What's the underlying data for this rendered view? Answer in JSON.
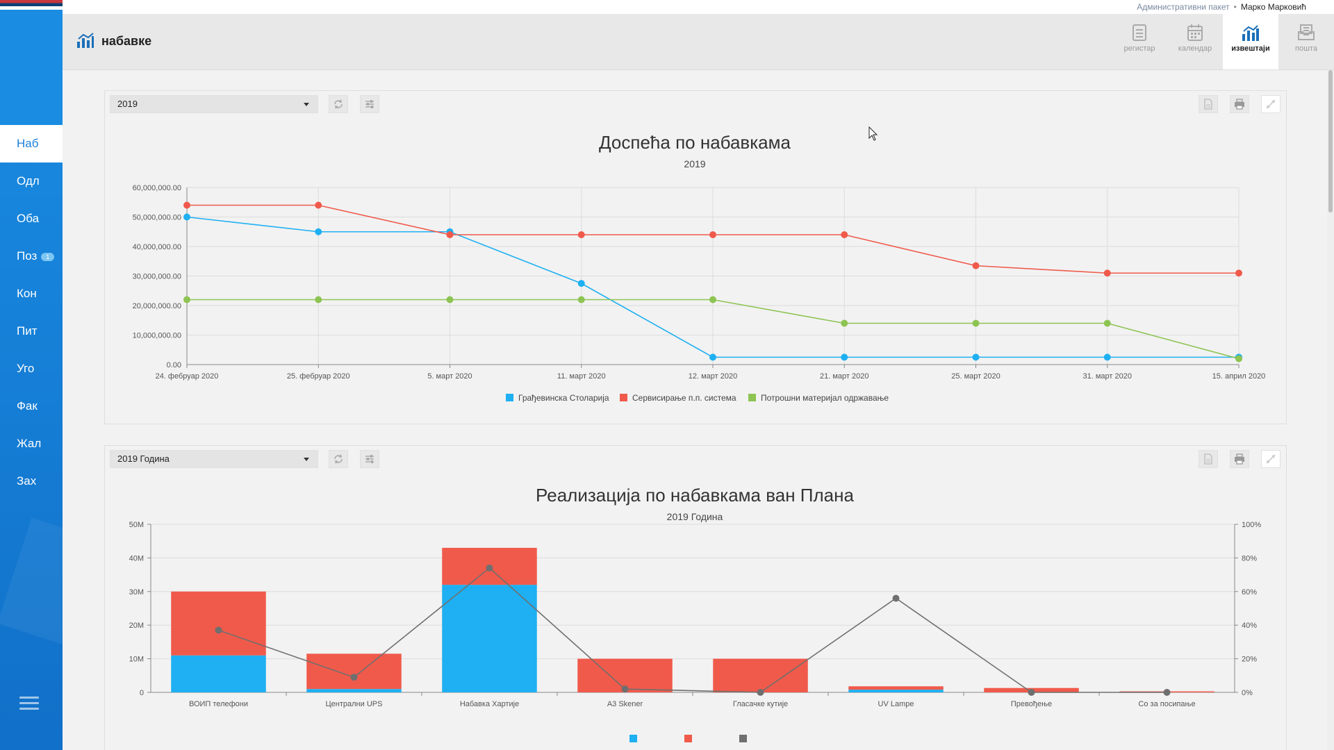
{
  "user_bar": {
    "package": "Административни пакет",
    "user": "Марко Марковић"
  },
  "header": {
    "title": "набавке",
    "tabs": [
      {
        "label": "регистар",
        "icon": "register-icon",
        "active": false
      },
      {
        "label": "календар",
        "icon": "calendar-icon",
        "active": false
      },
      {
        "label": "извештаји",
        "icon": "reports-icon",
        "active": true
      },
      {
        "label": "пошта",
        "icon": "mail-icon",
        "active": false
      }
    ]
  },
  "sidebar": {
    "items": [
      {
        "label": "Наб",
        "active": true
      },
      {
        "label": "Одл"
      },
      {
        "label": "Оба"
      },
      {
        "label": "Поз",
        "badge": "1"
      },
      {
        "label": "Кон"
      },
      {
        "label": "Пит"
      },
      {
        "label": "Уго"
      },
      {
        "label": "Фак"
      },
      {
        "label": "Жал"
      },
      {
        "label": "Зах"
      }
    ]
  },
  "panels": [
    {
      "dropdown_value": "2019"
    },
    {
      "dropdown_value": "2019 Година"
    }
  ],
  "colors": {
    "blue": "#1eb0f2",
    "red": "#f05a4b",
    "green": "#8dc452",
    "gray": "#6f6f6f",
    "accent": "#1a8de3"
  },
  "chart_data": [
    {
      "type": "line",
      "title": "Доспећа по набавкама",
      "subtitle": "2019",
      "categories": [
        "24. фебруар 2020",
        "25. фебруар 2020",
        "5. март 2020",
        "11. март 2020",
        "12. март 2020",
        "21. март 2020",
        "25. март 2020",
        "31. март 2020",
        "15. април 2020"
      ],
      "ylim": [
        0,
        60000000
      ],
      "yticks": [
        "0.00",
        "10,000,000.00",
        "20,000,000.00",
        "30,000,000.00",
        "40,000,000.00",
        "50,000,000.00",
        "60,000,000.00"
      ],
      "grid": true,
      "legend": "bottom",
      "series": [
        {
          "name": "Грађевинска Столарија",
          "color": "#1eb0f2",
          "values": [
            50000000,
            45000000,
            45000000,
            27500000,
            2500000,
            2500000,
            2500000,
            2500000,
            2500000
          ]
        },
        {
          "name": "Сервисирање п.п. система",
          "color": "#f05a4b",
          "values": [
            54000000,
            54000000,
            44000000,
            44000000,
            44000000,
            44000000,
            33500000,
            31000000,
            31000000
          ]
        },
        {
          "name": "Потрошни материјал одржавање",
          "color": "#8dc452",
          "values": [
            22000000,
            22000000,
            22000000,
            22000000,
            22000000,
            14000000,
            14000000,
            14000000,
            2000000
          ]
        }
      ]
    },
    {
      "type": "bar",
      "stacked": true,
      "title": "Реализација по набавкама ван Плана",
      "subtitle": "2019 Година",
      "categories": [
        "ВОИП телефони",
        "Централни UPS",
        "Набавка Хартије",
        "А3 Skener",
        "Гласачке кутије",
        "UV Lampe",
        "Превођење",
        "Со за посипање"
      ],
      "ylim": [
        0,
        50000000
      ],
      "yticks": [
        "0",
        "10M",
        "20M",
        "30M",
        "40M",
        "50M"
      ],
      "y2lim": [
        0,
        100
      ],
      "y2ticks": [
        "0%",
        "20%",
        "40%",
        "60%",
        "80%",
        "100%"
      ],
      "legend": "bottom",
      "series": [
        {
          "color": "#1eb0f2",
          "values": [
            11000000,
            1000000,
            32000000,
            0,
            0,
            800000,
            0,
            0
          ]
        },
        {
          "color": "#f05a4b",
          "values": [
            19000000,
            10500000,
            11000000,
            10000000,
            10000000,
            1000000,
            1300000,
            300000
          ]
        },
        {
          "color": "#6f6f6f",
          "kind": "line",
          "axis": "right",
          "values": [
            37,
            9,
            74,
            2,
            0,
            56,
            0,
            0
          ]
        }
      ]
    }
  ]
}
